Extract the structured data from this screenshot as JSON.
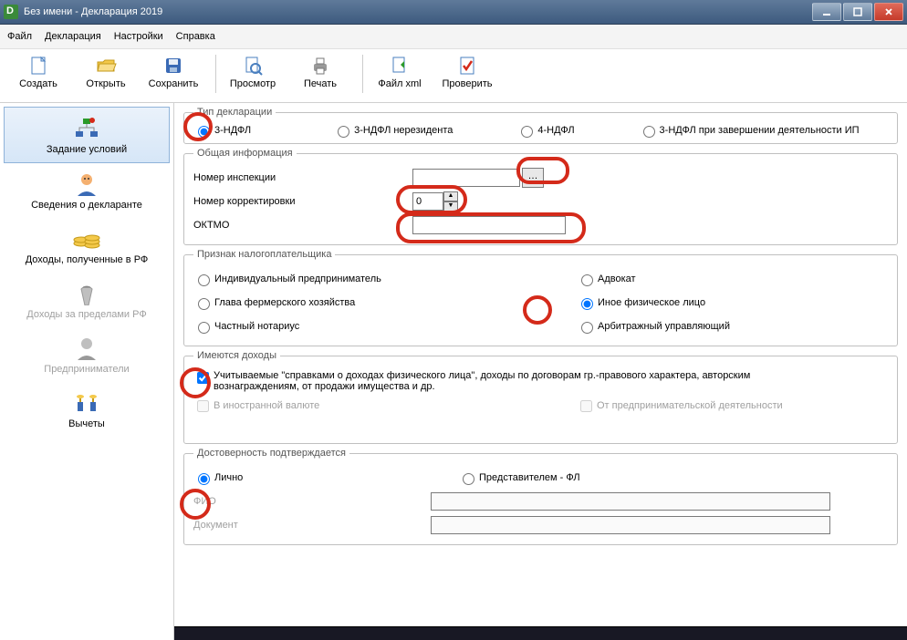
{
  "title": "Без имени - Декларация 2019",
  "menu": {
    "file": "Файл",
    "decl": "Декларация",
    "settings": "Настройки",
    "help": "Справка"
  },
  "toolbar": {
    "create": "Создать",
    "open": "Открыть",
    "save": "Сохранить",
    "preview": "Просмотр",
    "print": "Печать",
    "xml": "Файл xml",
    "check": "Проверить"
  },
  "nav": {
    "conditions": "Задание условий",
    "declarant": "Сведения о декларанте",
    "income_rf": "Доходы, полученные в РФ",
    "income_abroad": "Доходы за пределами РФ",
    "entrepreneurs": "Предприниматели",
    "deductions": "Вычеты"
  },
  "sections": {
    "decl_type": {
      "legend": "Тип декларации",
      "r1": "3-НДФЛ",
      "r2": "3-НДФЛ нерезидента",
      "r3": "4-НДФЛ",
      "r4": "3-НДФЛ при завершении деятельности ИП"
    },
    "general": {
      "legend": "Общая информация",
      "inspection": "Номер инспекции",
      "inspection_val": "",
      "correction": "Номер корректировки",
      "correction_val": "0",
      "oktmo": "ОКТМО",
      "oktmo_val": ""
    },
    "taxpayer": {
      "legend": "Признак налогоплательщика",
      "r1": "Индивидуальный предприниматель",
      "r2": "Адвокат",
      "r3": "Глава фермерского хозяйства",
      "r4": "Иное физическое лицо",
      "r5": "Частный нотариус",
      "r6": "Арбитражный управляющий"
    },
    "income": {
      "legend": "Имеются доходы",
      "c1": "Учитываемые \"справками о доходах физического лица\", доходы по договорам гр.-правового характера, авторским вознаграждениям, от продажи имущества и др.",
      "c2": "В иностранной валюте",
      "c3": "От предпринимательской деятельности"
    },
    "reliability": {
      "legend": "Достоверность подтверждается",
      "r1": "Лично",
      "r2": "Представителем - ФЛ",
      "fio": "ФИО",
      "fio_val": "",
      "doc": "Документ",
      "doc_val": ""
    }
  }
}
